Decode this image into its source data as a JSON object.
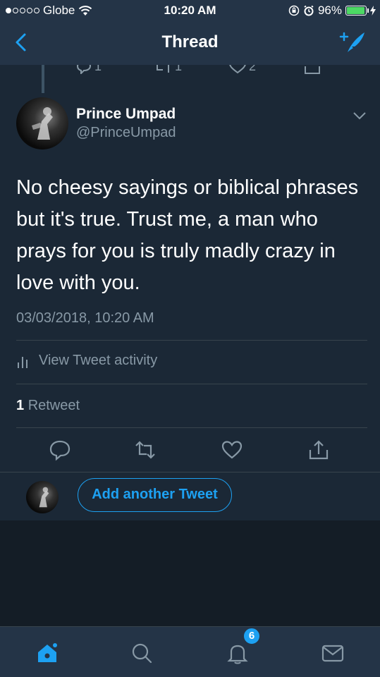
{
  "status_bar": {
    "carrier": "Globe",
    "time": "10:20 AM",
    "battery_percent": "96%",
    "battery_level": 0.96
  },
  "nav": {
    "title": "Thread",
    "back_icon": "chevron-left-icon",
    "compose_icon": "compose-tweet-icon"
  },
  "previous_tweet_actions": {
    "reply_count": "1",
    "retweet_count": "1",
    "like_count": "2"
  },
  "tweet": {
    "author_name": "Prince Umpad",
    "author_handle": "@PrinceUmpad",
    "text": "No cheesy sayings or biblical phrases but it's true. Trust me, a man who prays for you is truly madly crazy in love with you.",
    "timestamp": "03/03/2018, 10:20 AM",
    "activity_label": "View Tweet activity",
    "retweet_count": "1",
    "retweet_label": "Retweet"
  },
  "reply": {
    "button_label": "Add another Tweet"
  },
  "tab_bar": {
    "tabs": [
      "home-icon",
      "search-icon",
      "notifications-icon",
      "messages-icon"
    ],
    "notification_count": "6"
  },
  "colors": {
    "accent": "#1da1f2",
    "background": "#1b2836",
    "bar": "#243447",
    "secondary_text": "#8899a6"
  }
}
